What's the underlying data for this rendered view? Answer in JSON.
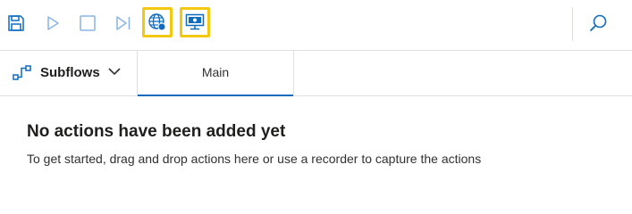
{
  "toolbar": {
    "save_icon": "save-icon",
    "run_icon": "play-icon",
    "stop_icon": "stop-icon",
    "step_icon": "run-next-action-icon",
    "web_recorder_icon": "globe-record-icon",
    "desktop_recorder_icon": "monitor-record-icon",
    "search_icon": "search-icon",
    "highlight_color": "#f2c811",
    "accent_color": "#0f6cbd"
  },
  "tabs": {
    "subflows_label": "Subflows",
    "main_label": "Main"
  },
  "empty_state": {
    "title": "No actions have been added yet",
    "description": "To get started, drag and drop actions here or use a recorder to capture the actions"
  }
}
